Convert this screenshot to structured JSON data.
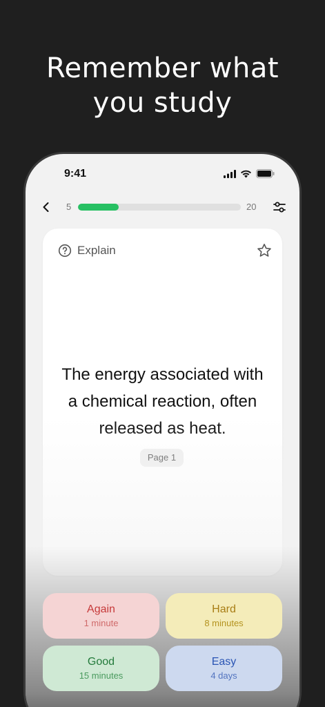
{
  "headline": {
    "line1": "Remember what",
    "line2": "you study"
  },
  "status_bar": {
    "time": "9:41",
    "icons": [
      "signal-icon",
      "wifi-icon",
      "battery-icon"
    ]
  },
  "toolbar": {
    "current": "5",
    "total": "20",
    "progress_fraction": 0.25,
    "accent_color": "#27c063",
    "icons": [
      "back-chevron-icon",
      "settings-sliders-icon"
    ]
  },
  "card": {
    "explain_label": "Explain",
    "text": "The energy associated with a chemical reaction, often released as heat.",
    "page_label": "Page 1",
    "icons": [
      "help-circle-icon",
      "star-icon"
    ]
  },
  "answers": [
    {
      "label": "Again",
      "interval": "1 minute",
      "color": "#c63a3a"
    },
    {
      "label": "Hard",
      "interval": "8 minutes",
      "color": "#a87d14"
    },
    {
      "label": "Good",
      "interval": "15 minutes",
      "color": "#237a3b"
    },
    {
      "label": "Easy",
      "interval": "4 days",
      "color": "#2a55b4"
    }
  ]
}
